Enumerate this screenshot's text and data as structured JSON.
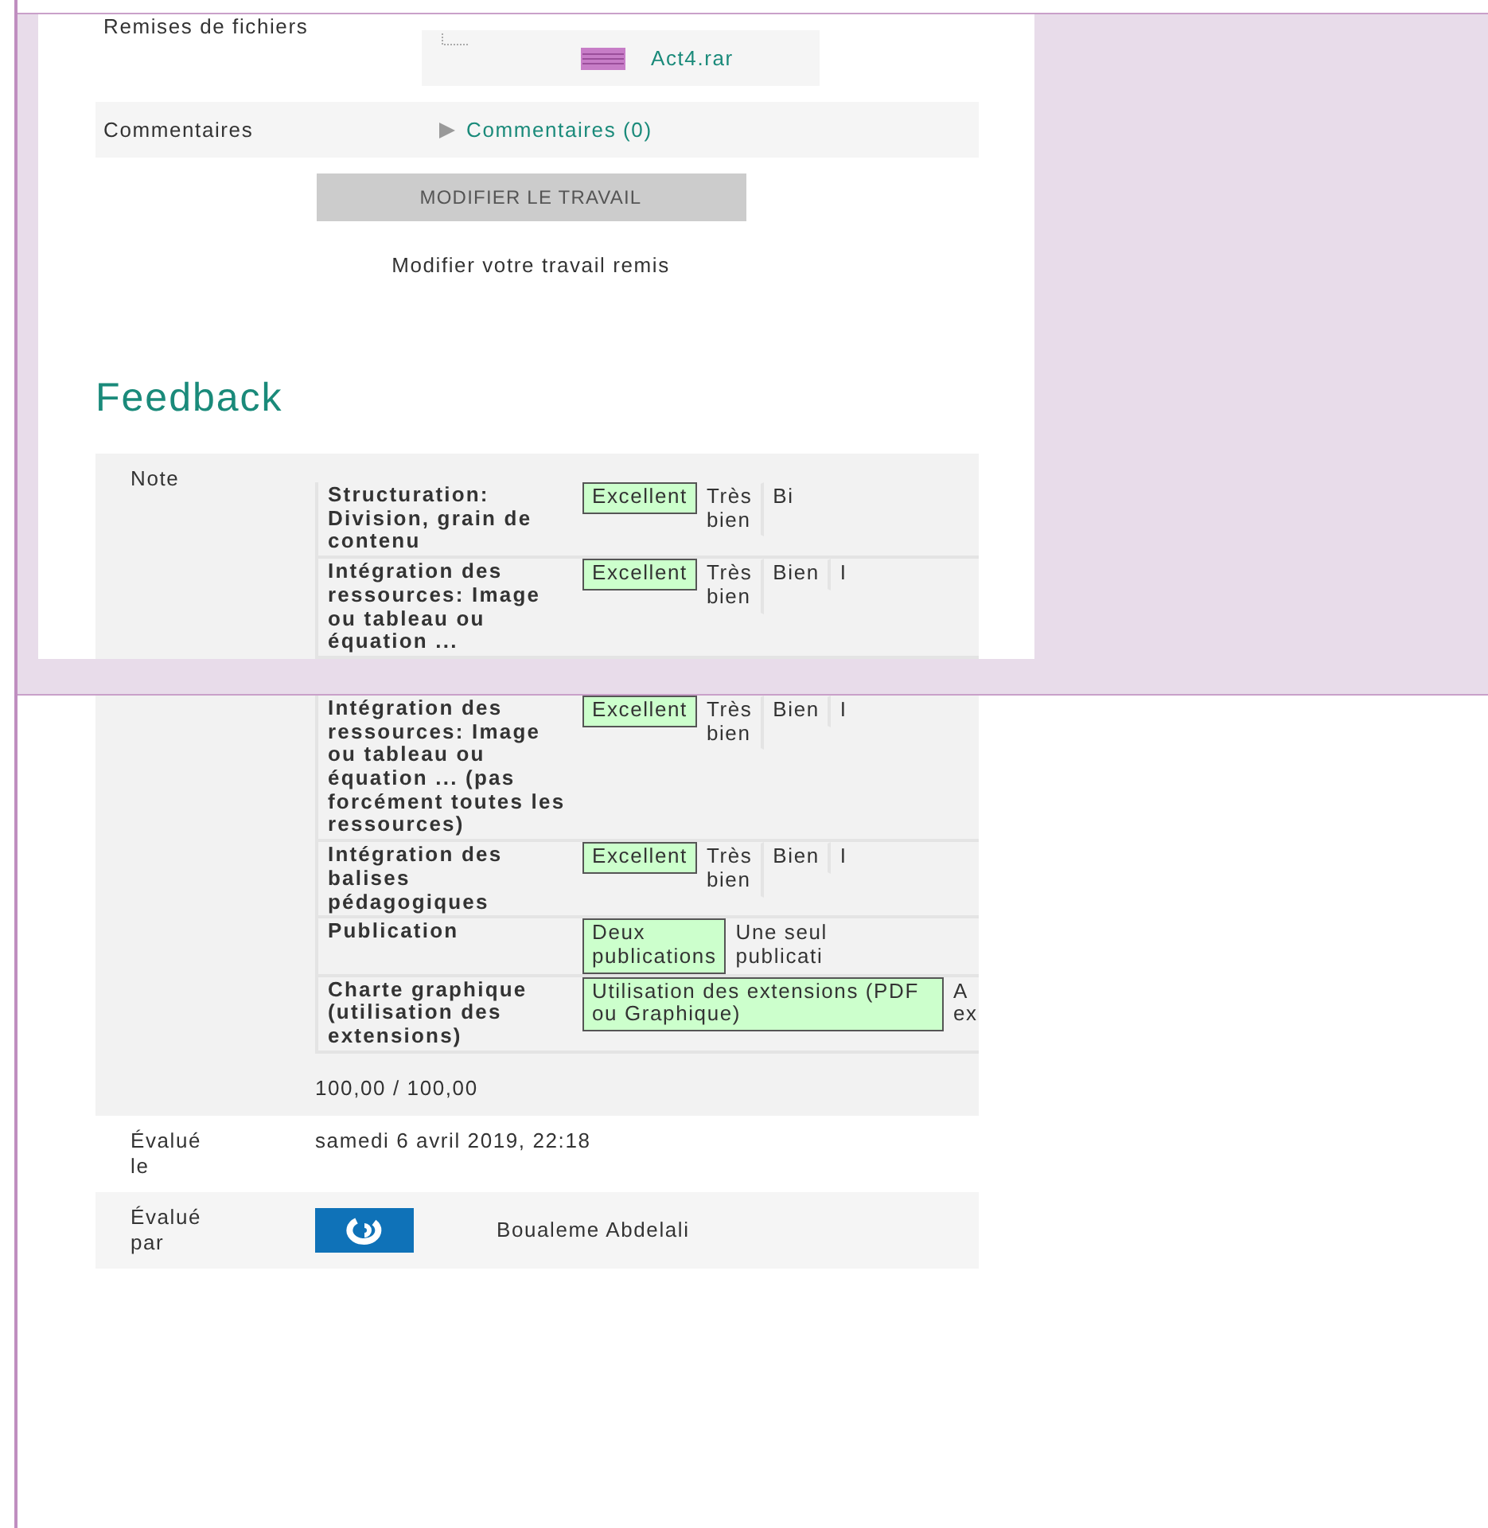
{
  "top": {
    "submission_rows": [
      {
        "kind": "file",
        "label": "Remises de fichiers",
        "value": "Act4.rar"
      },
      {
        "kind": "comments",
        "label": "Commentaires",
        "value": "Commentaires (0)"
      }
    ],
    "button": "MODIFIER LE TRAVAIL",
    "button_caption": "Modifier votre travail remis",
    "heading": "Feedback",
    "grade_label": "Note",
    "rubric": [
      {
        "criterion": "Structuration: Division, grain de contenu",
        "levels": [
          {
            "text": "Excellent",
            "selected": true
          },
          {
            "text": "Très bien",
            "selected": false
          },
          {
            "text": "Bi",
            "selected": false
          }
        ]
      },
      {
        "criterion": "Intégration des ressources: Image ou tableau ou équation ...",
        "levels": [
          {
            "text": "Excellent",
            "selected": true
          },
          {
            "text": "Très bien",
            "selected": false
          },
          {
            "text": "Bien",
            "selected": false
          },
          {
            "text": "I",
            "selected": false
          }
        ]
      }
    ]
  },
  "bottom": {
    "rubric": [
      {
        "criterion": "Intégration des ressources: Image ou tableau ou équation ... (pas forcément toutes les ressources)",
        "levels": [
          {
            "text": "Excellent",
            "selected": true
          },
          {
            "text": "Très bien",
            "selected": false
          },
          {
            "text": "Bien",
            "selected": false
          },
          {
            "text": "I",
            "selected": false
          }
        ]
      },
      {
        "criterion": "Intégration des balises pédagogiques",
        "levels": [
          {
            "text": "Excellent",
            "selected": true
          },
          {
            "text": "Très bien",
            "selected": false
          },
          {
            "text": "Bien",
            "selected": false
          },
          {
            "text": "I",
            "selected": false
          }
        ]
      },
      {
        "criterion": "Publication",
        "levels": [
          {
            "text": "Deux publications",
            "selected": true
          },
          {
            "text": "Une seul\npublicati",
            "selected": false
          }
        ]
      },
      {
        "criterion": "Charte graphique (utilisation des extensions)",
        "levels": [
          {
            "text": "Utilisation des extensions (PDF ou Graphique)",
            "selected": true
          },
          {
            "text": "A\nex",
            "selected": false
          }
        ]
      }
    ],
    "total": "100,00 / 100,00",
    "details": [
      {
        "kind": "date",
        "label": "Évalué le",
        "value": "samedi 6 avril 2019, 22:18"
      },
      {
        "kind": "person",
        "label": "Évalué par",
        "value": "Boualeme Abdelali"
      }
    ]
  }
}
